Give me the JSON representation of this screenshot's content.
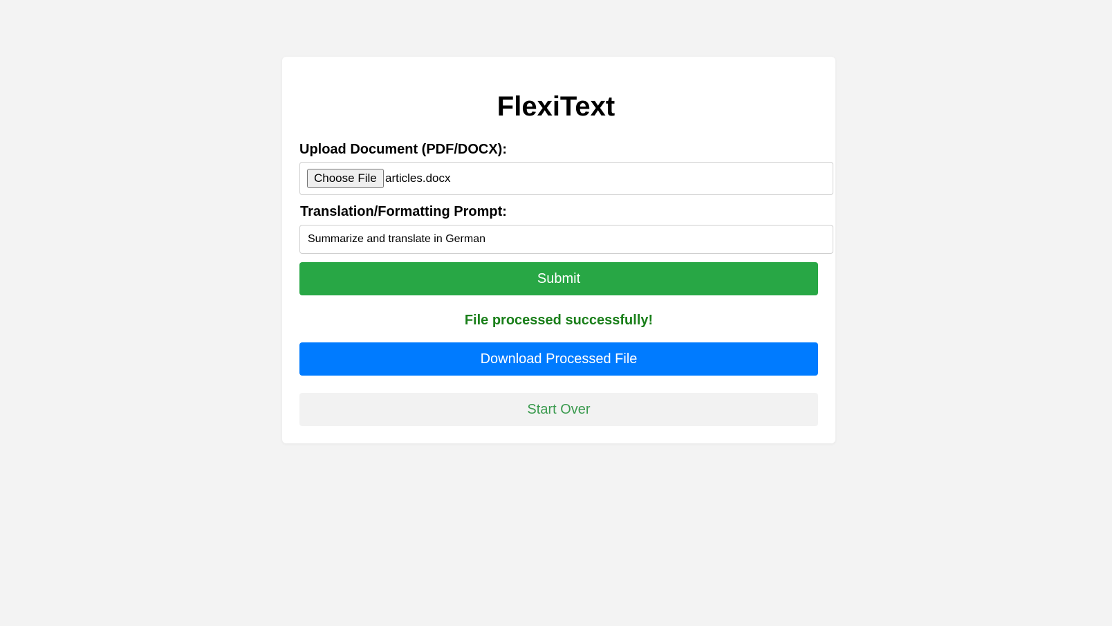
{
  "app": {
    "title": "FlexiText"
  },
  "upload": {
    "label": "Upload Document (PDF/DOCX):",
    "button_label": "Choose File",
    "file_name": "articles.docx"
  },
  "prompt": {
    "label": "Translation/Formatting Prompt:",
    "value": "Summarize and translate in German"
  },
  "actions": {
    "submit_label": "Submit",
    "status_message": "File processed successfully!",
    "download_label": "Download Processed File",
    "start_over_label": "Start Over"
  },
  "colors": {
    "background": "#f3f3f3",
    "card": "#ffffff",
    "submit": "#28a745",
    "download": "#007bff",
    "start_over_bg": "#f2f2f2",
    "start_over_text": "#3a9a4e",
    "status_text": "#1a7f1a"
  }
}
